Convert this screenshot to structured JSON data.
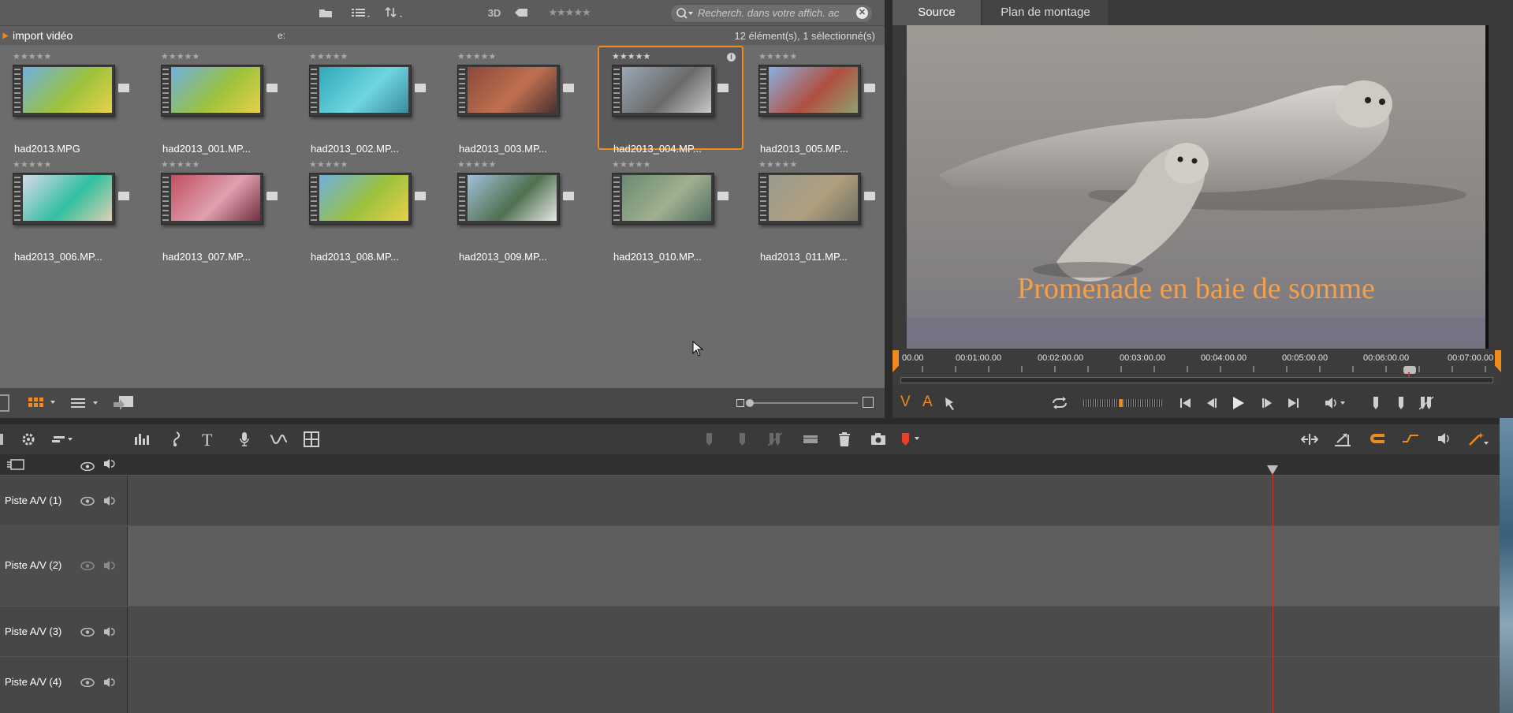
{
  "library": {
    "toolbar": {
      "label_3d": "3D",
      "search_placeholder": "Recherch. dans votre affich. ac"
    },
    "header": {
      "title": "import vidéo",
      "drive": "e:",
      "count": "12 élément(s), 1 sélectionné(s)"
    },
    "items": [
      {
        "name": "had2013.MPG",
        "stars": "★★★★★"
      },
      {
        "name": "had2013_001.MP...",
        "stars": "★★★★★"
      },
      {
        "name": "had2013_002.MP...",
        "stars": "★★★★★"
      },
      {
        "name": "had2013_003.MP...",
        "stars": "★★★★★"
      },
      {
        "name": "had2013_004.MP...",
        "stars": "★★★★★",
        "selected": true
      },
      {
        "name": "had2013_005.MP...",
        "stars": "★★★★★"
      },
      {
        "name": "had2013_006.MP...",
        "stars": "★★★★★"
      },
      {
        "name": "had2013_007.MP...",
        "stars": "★★★★★"
      },
      {
        "name": "had2013_008.MP...",
        "stars": "★★★★★"
      },
      {
        "name": "had2013_009.MP...",
        "stars": "★★★★★"
      },
      {
        "name": "had2013_010.MP...",
        "stars": "★★★★★"
      },
      {
        "name": "had2013_011.MP...",
        "stars": "★★★★★"
      }
    ]
  },
  "preview": {
    "tabs": [
      "Source",
      "Plan de montage"
    ],
    "overlay_title": "Promenade en baie de somme",
    "ruler": [
      "00.00",
      "00:01:00.00",
      "00:02:00.00",
      "00:03:00.00",
      "00:04:00.00",
      "00:05:00.00",
      "00:06:00.00",
      "00:07:00.00"
    ],
    "v_label": "V",
    "a_label": "A"
  },
  "timeline": {
    "tracks": [
      "Piste A/V (1)",
      "Piste A/V (2)",
      "Piste A/V (3)",
      "Piste A/V (4)"
    ]
  },
  "colors": {
    "accent": "#f08a1c",
    "playhead": "#d0302a",
    "panel": "#6c6c6c"
  }
}
